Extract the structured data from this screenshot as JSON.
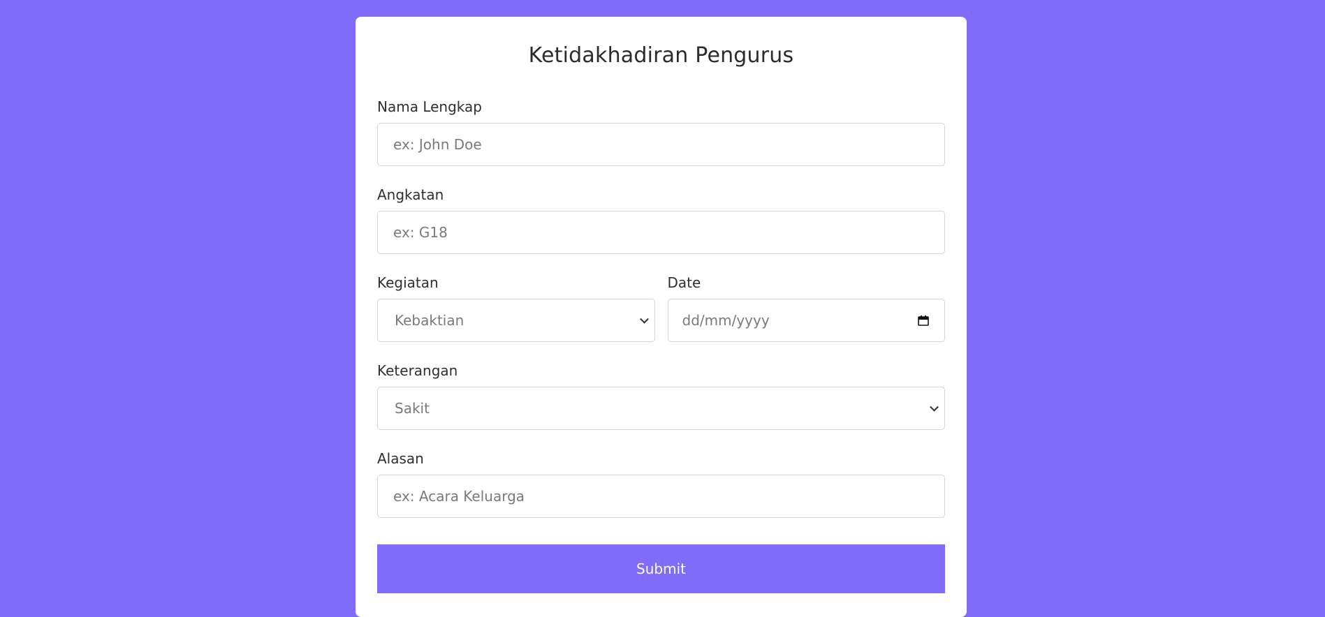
{
  "form": {
    "title": "Ketidakhadiran Pengurus",
    "nama": {
      "label": "Nama Lengkap",
      "placeholder": "ex: John Doe"
    },
    "angkatan": {
      "label": "Angkatan",
      "placeholder": "ex: G18"
    },
    "kegiatan": {
      "label": "Kegiatan",
      "value": "Kebaktian"
    },
    "date": {
      "label": "Date",
      "placeholder": "dd/mm/yyyy"
    },
    "keterangan": {
      "label": "Keterangan",
      "value": "Sakit"
    },
    "alasan": {
      "label": "Alasan",
      "placeholder": "ex: Acara Keluarga"
    },
    "submit_label": "Submit"
  },
  "colors": {
    "background": "#816cfa",
    "card": "#ffffff",
    "button": "#816cfa"
  }
}
